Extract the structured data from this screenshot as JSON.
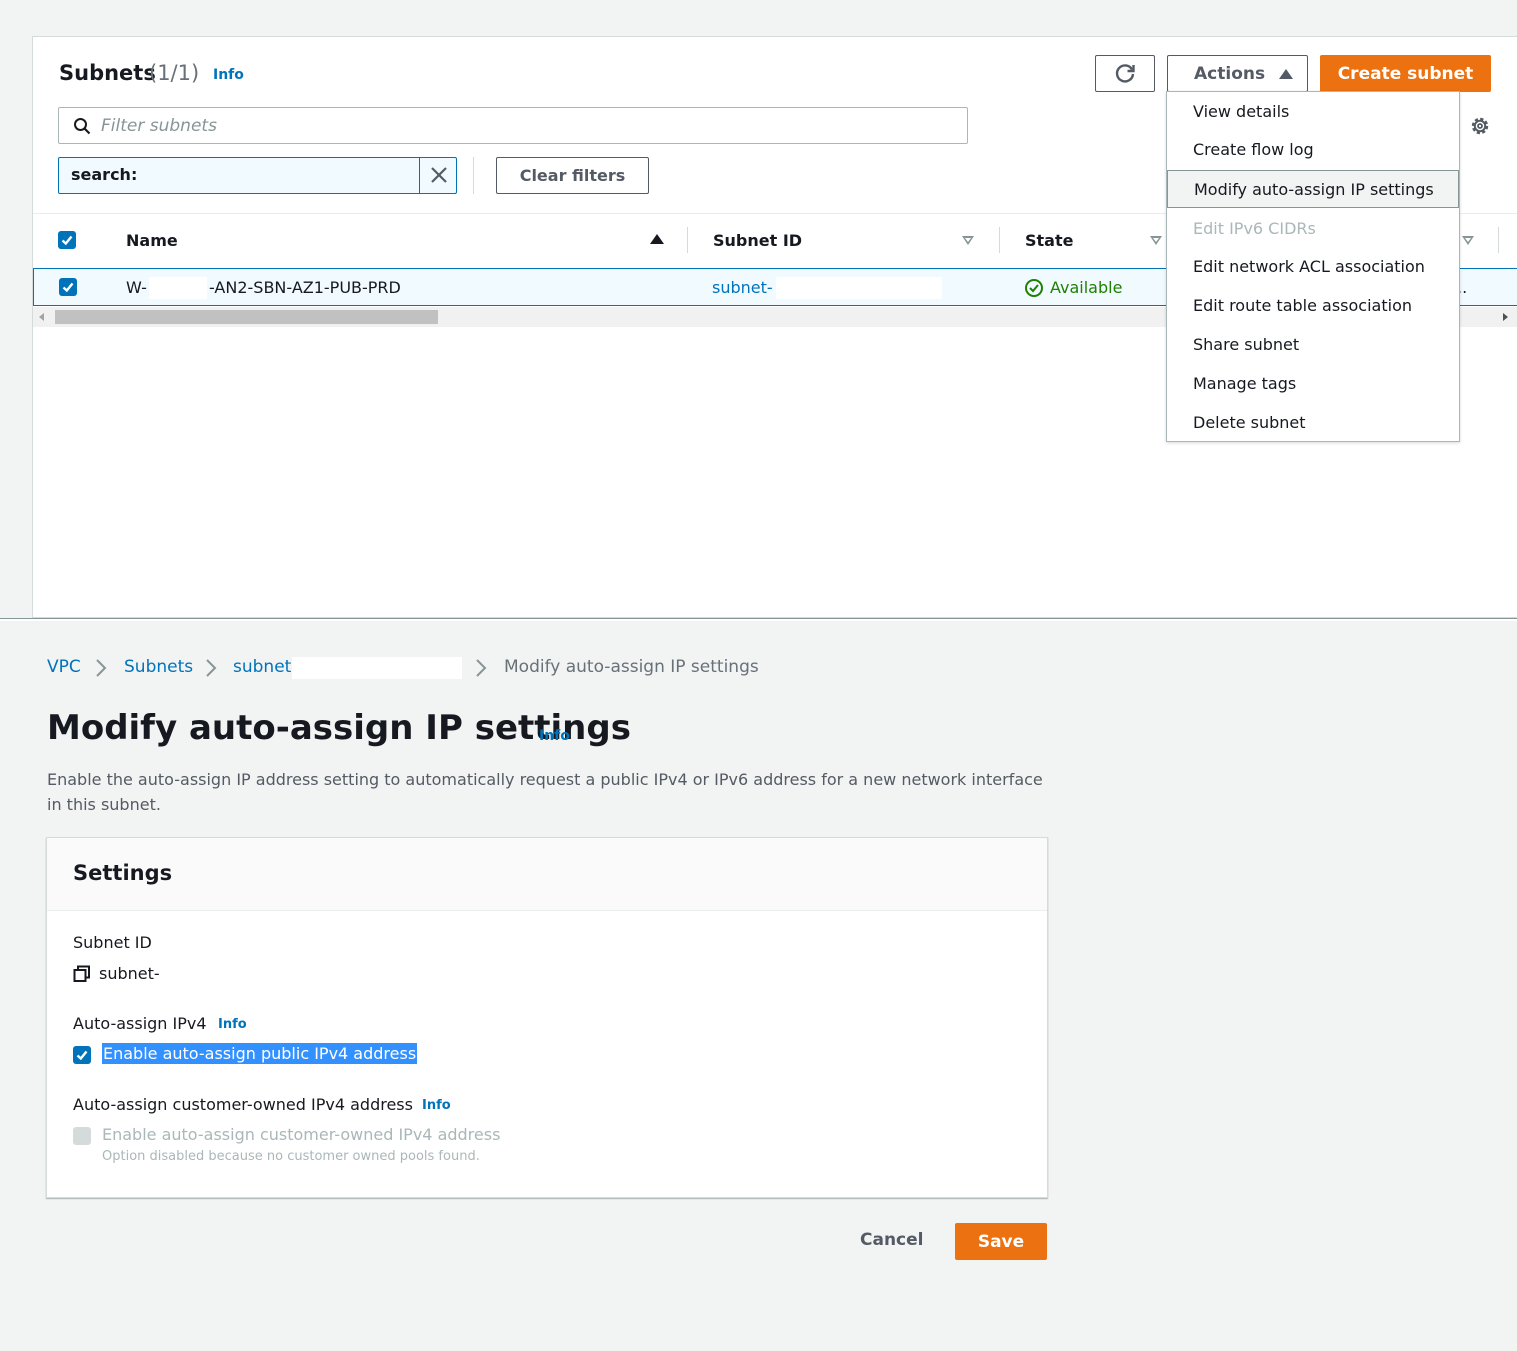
{
  "subnets_panel": {
    "title": "Subnets",
    "count": "(1/1)",
    "info_label": "Info",
    "actions_label": "Actions",
    "create_label": "Create subnet",
    "filter_placeholder": "Filter subnets",
    "token_label": "search:",
    "clear_filters_label": "Clear filters",
    "columns": [
      "Name",
      "Subnet ID",
      "State"
    ],
    "row": {
      "name_prefix": "W-",
      "name_suffix": "-AN2-SBN-AZ1-PUB-PRD",
      "subnet_id": "subnet-",
      "state": "Available",
      "overflow": ".."
    },
    "menu_items": [
      {
        "label": "View details",
        "state": "normal"
      },
      {
        "label": "Create flow log",
        "state": "normal"
      },
      {
        "label": "Modify auto-assign IP settings",
        "state": "active"
      },
      {
        "label": "Edit IPv6 CIDRs",
        "state": "disabled"
      },
      {
        "label": "Edit network ACL association",
        "state": "normal"
      },
      {
        "label": "Edit route table association",
        "state": "normal"
      },
      {
        "label": "Share subnet",
        "state": "normal"
      },
      {
        "label": "Manage tags",
        "state": "normal"
      },
      {
        "label": "Delete subnet",
        "state": "normal"
      }
    ]
  },
  "breadcrumb": [
    "VPC",
    "Subnets",
    "subnet-",
    "Modify auto-assign IP settings"
  ],
  "page": {
    "title": "Modify auto-assign IP settings",
    "info_label": "Info",
    "description": "Enable the auto-assign IP address setting to automatically request a public IPv4 or IPv6 address for a new network interface in this subnet."
  },
  "settings": {
    "title": "Settings",
    "subnet_id_label": "Subnet ID",
    "subnet_id_value": "subnet-",
    "ipv4_label": "Auto-assign IPv4",
    "ipv4_info": "Info",
    "ipv4_checkbox_label": "Enable auto-assign public IPv4 address",
    "ipv4_checked": true,
    "coip_label": "Auto-assign customer-owned IPv4 address",
    "coip_info": "Info",
    "coip_checkbox_label": "Enable auto-assign customer-owned IPv4 address",
    "coip_help": "Option disabled because no customer owned pools found.",
    "coip_checked": false
  },
  "footer": {
    "cancel_label": "Cancel",
    "save_label": "Save"
  },
  "colors": {
    "accent": "#ec7211",
    "link": "#0073bb",
    "success": "#1d8102"
  }
}
